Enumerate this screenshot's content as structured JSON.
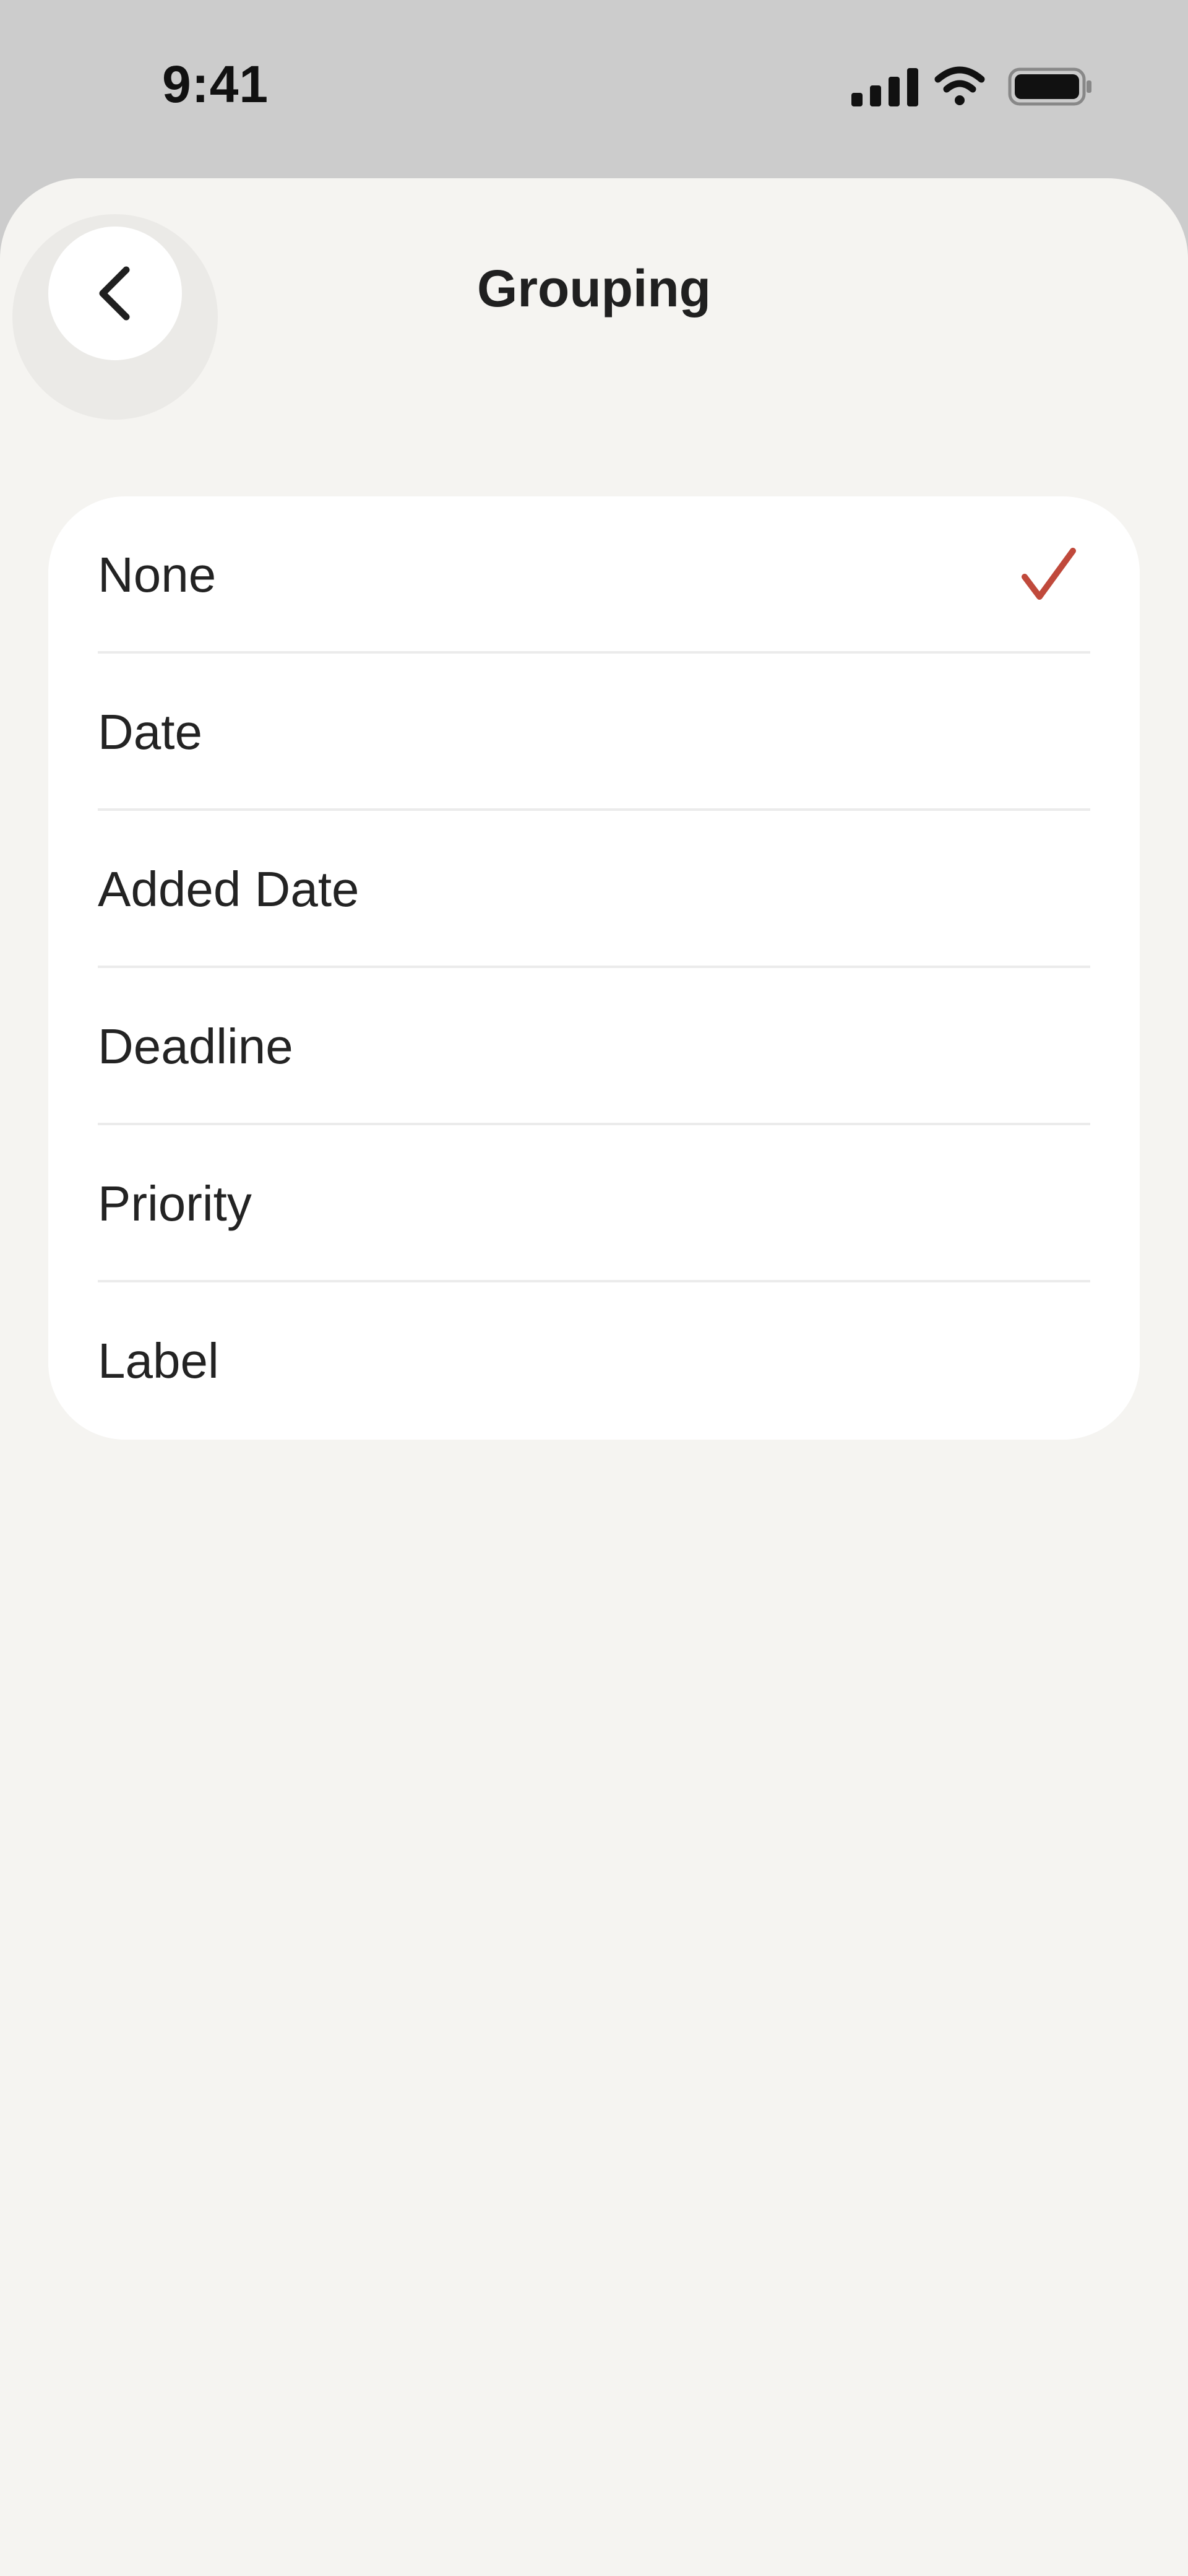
{
  "status_bar": {
    "time": "9:41"
  },
  "header": {
    "title": "Grouping",
    "back_icon": "chevron-left-icon"
  },
  "options": [
    {
      "label": "None",
      "selected": true
    },
    {
      "label": "Date",
      "selected": false
    },
    {
      "label": "Added Date",
      "selected": false
    },
    {
      "label": "Deadline",
      "selected": false
    },
    {
      "label": "Priority",
      "selected": false
    },
    {
      "label": "Label",
      "selected": false
    }
  ],
  "colors": {
    "accent": "#c0493b",
    "background": "#f5f4f1",
    "status_bar": "#cccccc"
  }
}
